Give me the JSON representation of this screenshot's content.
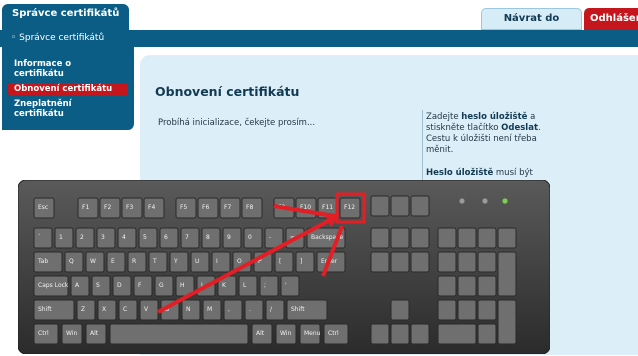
{
  "header": {
    "app_title": "Správce certifikátů",
    "back_label": "Návrat do aplikace",
    "logout_label": "Odhlášení"
  },
  "breadcrumb": "◦ Správce certifikátů",
  "sidebar": {
    "items": [
      {
        "label": "Informace o certifikátu",
        "active": false
      },
      {
        "label": "Obnovení certifikátu",
        "active": true
      },
      {
        "label": "Zneplatnění certifikátu",
        "active": false
      }
    ]
  },
  "main": {
    "title": "Obnovení certifikátu",
    "status": "Probíhá inicializace, čekejte prosím..."
  },
  "help": {
    "p1_pre": "Zadejte ",
    "p1_bold1": "heslo úložiště",
    "p1_mid": " a stiskněte tlačítko ",
    "p1_bold2": "Odeslat",
    "p1_post": ". Cestu k úložišti není třeba měnit.",
    "p2_bold": "Heslo úložiště",
    "p2_post": " musí být"
  },
  "keyboard": {
    "highlighted_key": "F12",
    "function_row": [
      "Esc",
      "F1",
      "F2",
      "F3",
      "F4",
      "F5",
      "F6",
      "F7",
      "F8",
      "F9",
      "F10",
      "F11",
      "F12"
    ],
    "row1": [
      "`",
      "1",
      "2",
      "3",
      "4",
      "5",
      "6",
      "7",
      "8",
      "9",
      "0",
      "-",
      "=",
      "Backspace"
    ],
    "row2": [
      "Tab",
      "Q",
      "W",
      "E",
      "R",
      "T",
      "Y",
      "U",
      "I",
      "O",
      "P",
      "[",
      "]",
      "Enter"
    ],
    "row3": [
      "Caps Lock",
      "A",
      "S",
      "D",
      "F",
      "G",
      "H",
      "J",
      "K",
      "L",
      ";",
      "'"
    ],
    "row4": [
      "Shift",
      "Z",
      "X",
      "C",
      "V",
      "B",
      "N",
      "M",
      ",",
      ".",
      "/",
      "Shift"
    ],
    "row5": [
      "Ctrl",
      "Win",
      "Alt",
      "",
      "Alt",
      "Win",
      "Menu",
      "Ctrl"
    ],
    "colors": {
      "body": "#3a3a3a",
      "key": "#6b6b6b",
      "highlight": "#e31e24",
      "led_green": "#7bd14b"
    }
  }
}
